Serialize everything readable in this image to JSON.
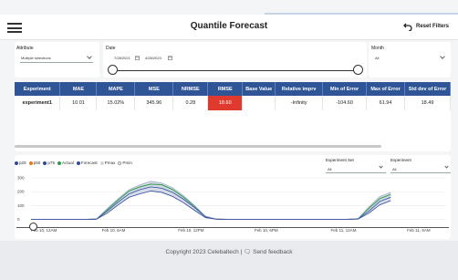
{
  "header": {
    "title": "Quantile Forecast",
    "reset_label": "Reset Filters"
  },
  "filters": {
    "attribute": {
      "label": "Attribute",
      "value": "Multiple selections"
    },
    "date": {
      "label": "Date",
      "start": "7/28/2021",
      "end": "4/28/2023"
    },
    "month": {
      "label": "Month",
      "value": "All"
    }
  },
  "table": {
    "columns": [
      "Experiment",
      "MAE",
      "MAPE",
      "MSE",
      "NRMSE",
      "RMSE",
      "Base Value",
      "Relative imprv",
      "Min of Error",
      "Max of Error",
      "Std dev of Error"
    ],
    "rows": [
      [
        "experiment1",
        "10.01",
        "15.02%",
        "345.96",
        "0.28",
        "18.60",
        "",
        "-Infinity",
        "-104.60",
        "61.94",
        "18.49"
      ]
    ]
  },
  "legend": [
    {
      "name": "p25",
      "color": "#2f4a9c"
    },
    {
      "name": "p50",
      "color": "#e8771e"
    },
    {
      "name": "p75",
      "color": "#2f4a9c"
    },
    {
      "name": "Actual",
      "color": "#2e9a4a"
    },
    {
      "name": "Forecast",
      "color": "#2f4a9c"
    },
    {
      "name": "Pmax",
      "color": "#cfd6e3"
    },
    {
      "name": "Pmin",
      "color": "#ffffff"
    }
  ],
  "experiment_set": {
    "label": "Experiment Set",
    "value": "All"
  },
  "experiment": {
    "label": "Experiment",
    "value": "All"
  },
  "chart_data": {
    "type": "line",
    "x": [
      "Feb 10, 12AM",
      "Feb 10, 6AM",
      "Feb 10, 12PM",
      "Feb 10, 6PM",
      "Feb 11, 12AM",
      "Feb 11, 6AM"
    ],
    "yticks": [
      0,
      100,
      200,
      300
    ],
    "ylim": [
      -10,
      320
    ],
    "series": [
      {
        "name": "Actual",
        "color": "#2e9a4a",
        "points": [
          [
            0,
            0
          ],
          [
            1,
            0
          ],
          [
            2,
            0
          ],
          [
            3,
            0
          ],
          [
            4,
            0
          ],
          [
            5,
            0
          ],
          [
            6,
            2
          ],
          [
            7,
            70
          ],
          [
            8,
            140
          ],
          [
            9,
            205
          ],
          [
            10,
            235
          ],
          [
            11,
            255
          ],
          [
            12,
            250
          ],
          [
            13,
            215
          ],
          [
            14,
            160
          ],
          [
            15,
            95
          ],
          [
            16,
            20
          ],
          [
            17,
            2
          ],
          [
            18,
            0
          ],
          [
            19,
            0
          ],
          [
            20,
            0
          ],
          [
            21,
            0
          ],
          [
            22,
            0
          ],
          [
            23,
            0
          ],
          [
            24,
            0
          ],
          [
            25,
            0
          ],
          [
            26,
            0
          ],
          [
            27,
            0
          ],
          [
            28,
            0
          ],
          [
            29,
            0
          ],
          [
            30,
            5
          ],
          [
            31,
            80
          ],
          [
            32,
            150
          ],
          [
            33,
            180
          ]
        ]
      },
      {
        "name": "Forecast",
        "color": "#2f4a9c",
        "points": [
          [
            0,
            0
          ],
          [
            1,
            0
          ],
          [
            2,
            0
          ],
          [
            3,
            0
          ],
          [
            4,
            0
          ],
          [
            5,
            0
          ],
          [
            6,
            2
          ],
          [
            7,
            60
          ],
          [
            8,
            125
          ],
          [
            9,
            185
          ],
          [
            10,
            215
          ],
          [
            11,
            235
          ],
          [
            12,
            225
          ],
          [
            13,
            195
          ],
          [
            14,
            145
          ],
          [
            15,
            85
          ],
          [
            16,
            18
          ],
          [
            17,
            2
          ],
          [
            18,
            0
          ],
          [
            19,
            0
          ],
          [
            20,
            0
          ],
          [
            21,
            0
          ],
          [
            22,
            0
          ],
          [
            23,
            0
          ],
          [
            24,
            0
          ],
          [
            25,
            0
          ],
          [
            26,
            0
          ],
          [
            27,
            0
          ],
          [
            28,
            0
          ],
          [
            29,
            0
          ],
          [
            30,
            4
          ],
          [
            31,
            60
          ],
          [
            32,
            130
          ],
          [
            33,
            160
          ]
        ]
      },
      {
        "name": "Pmax",
        "color": "#9fb0cf",
        "points": [
          [
            0,
            0
          ],
          [
            1,
            0
          ],
          [
            2,
            0
          ],
          [
            3,
            0
          ],
          [
            4,
            0
          ],
          [
            5,
            0
          ],
          [
            6,
            4
          ],
          [
            7,
            78
          ],
          [
            8,
            150
          ],
          [
            9,
            215
          ],
          [
            10,
            250
          ],
          [
            11,
            275
          ],
          [
            12,
            262
          ],
          [
            13,
            228
          ],
          [
            14,
            170
          ],
          [
            15,
            100
          ],
          [
            16,
            24
          ],
          [
            17,
            3
          ],
          [
            18,
            0
          ],
          [
            19,
            0
          ],
          [
            20,
            0
          ],
          [
            21,
            0
          ],
          [
            22,
            0
          ],
          [
            23,
            0
          ],
          [
            24,
            0
          ],
          [
            25,
            0
          ],
          [
            26,
            0
          ],
          [
            27,
            0
          ],
          [
            28,
            0
          ],
          [
            29,
            0
          ],
          [
            30,
            6
          ],
          [
            31,
            90
          ],
          [
            32,
            165
          ],
          [
            33,
            195
          ]
        ]
      },
      {
        "name": "Pmin",
        "color": "#2f4a9c",
        "points": [
          [
            0,
            0
          ],
          [
            1,
            0
          ],
          [
            2,
            0
          ],
          [
            3,
            0
          ],
          [
            4,
            0
          ],
          [
            5,
            0
          ],
          [
            6,
            1
          ],
          [
            7,
            45
          ],
          [
            8,
            105
          ],
          [
            9,
            160
          ],
          [
            10,
            185
          ],
          [
            11,
            205
          ],
          [
            12,
            195
          ],
          [
            13,
            165
          ],
          [
            14,
            120
          ],
          [
            15,
            65
          ],
          [
            16,
            12
          ],
          [
            17,
            1
          ],
          [
            18,
            0
          ],
          [
            19,
            0
          ],
          [
            20,
            0
          ],
          [
            21,
            0
          ],
          [
            22,
            0
          ],
          [
            23,
            0
          ],
          [
            24,
            0
          ],
          [
            25,
            0
          ],
          [
            26,
            0
          ],
          [
            27,
            0
          ],
          [
            28,
            0
          ],
          [
            29,
            0
          ],
          [
            30,
            2
          ],
          [
            31,
            45
          ],
          [
            32,
            105
          ],
          [
            33,
            135
          ]
        ]
      }
    ]
  },
  "footer": {
    "copyright": "Copyright 2023 Celebaltech |",
    "feedback": "Send feedback"
  }
}
